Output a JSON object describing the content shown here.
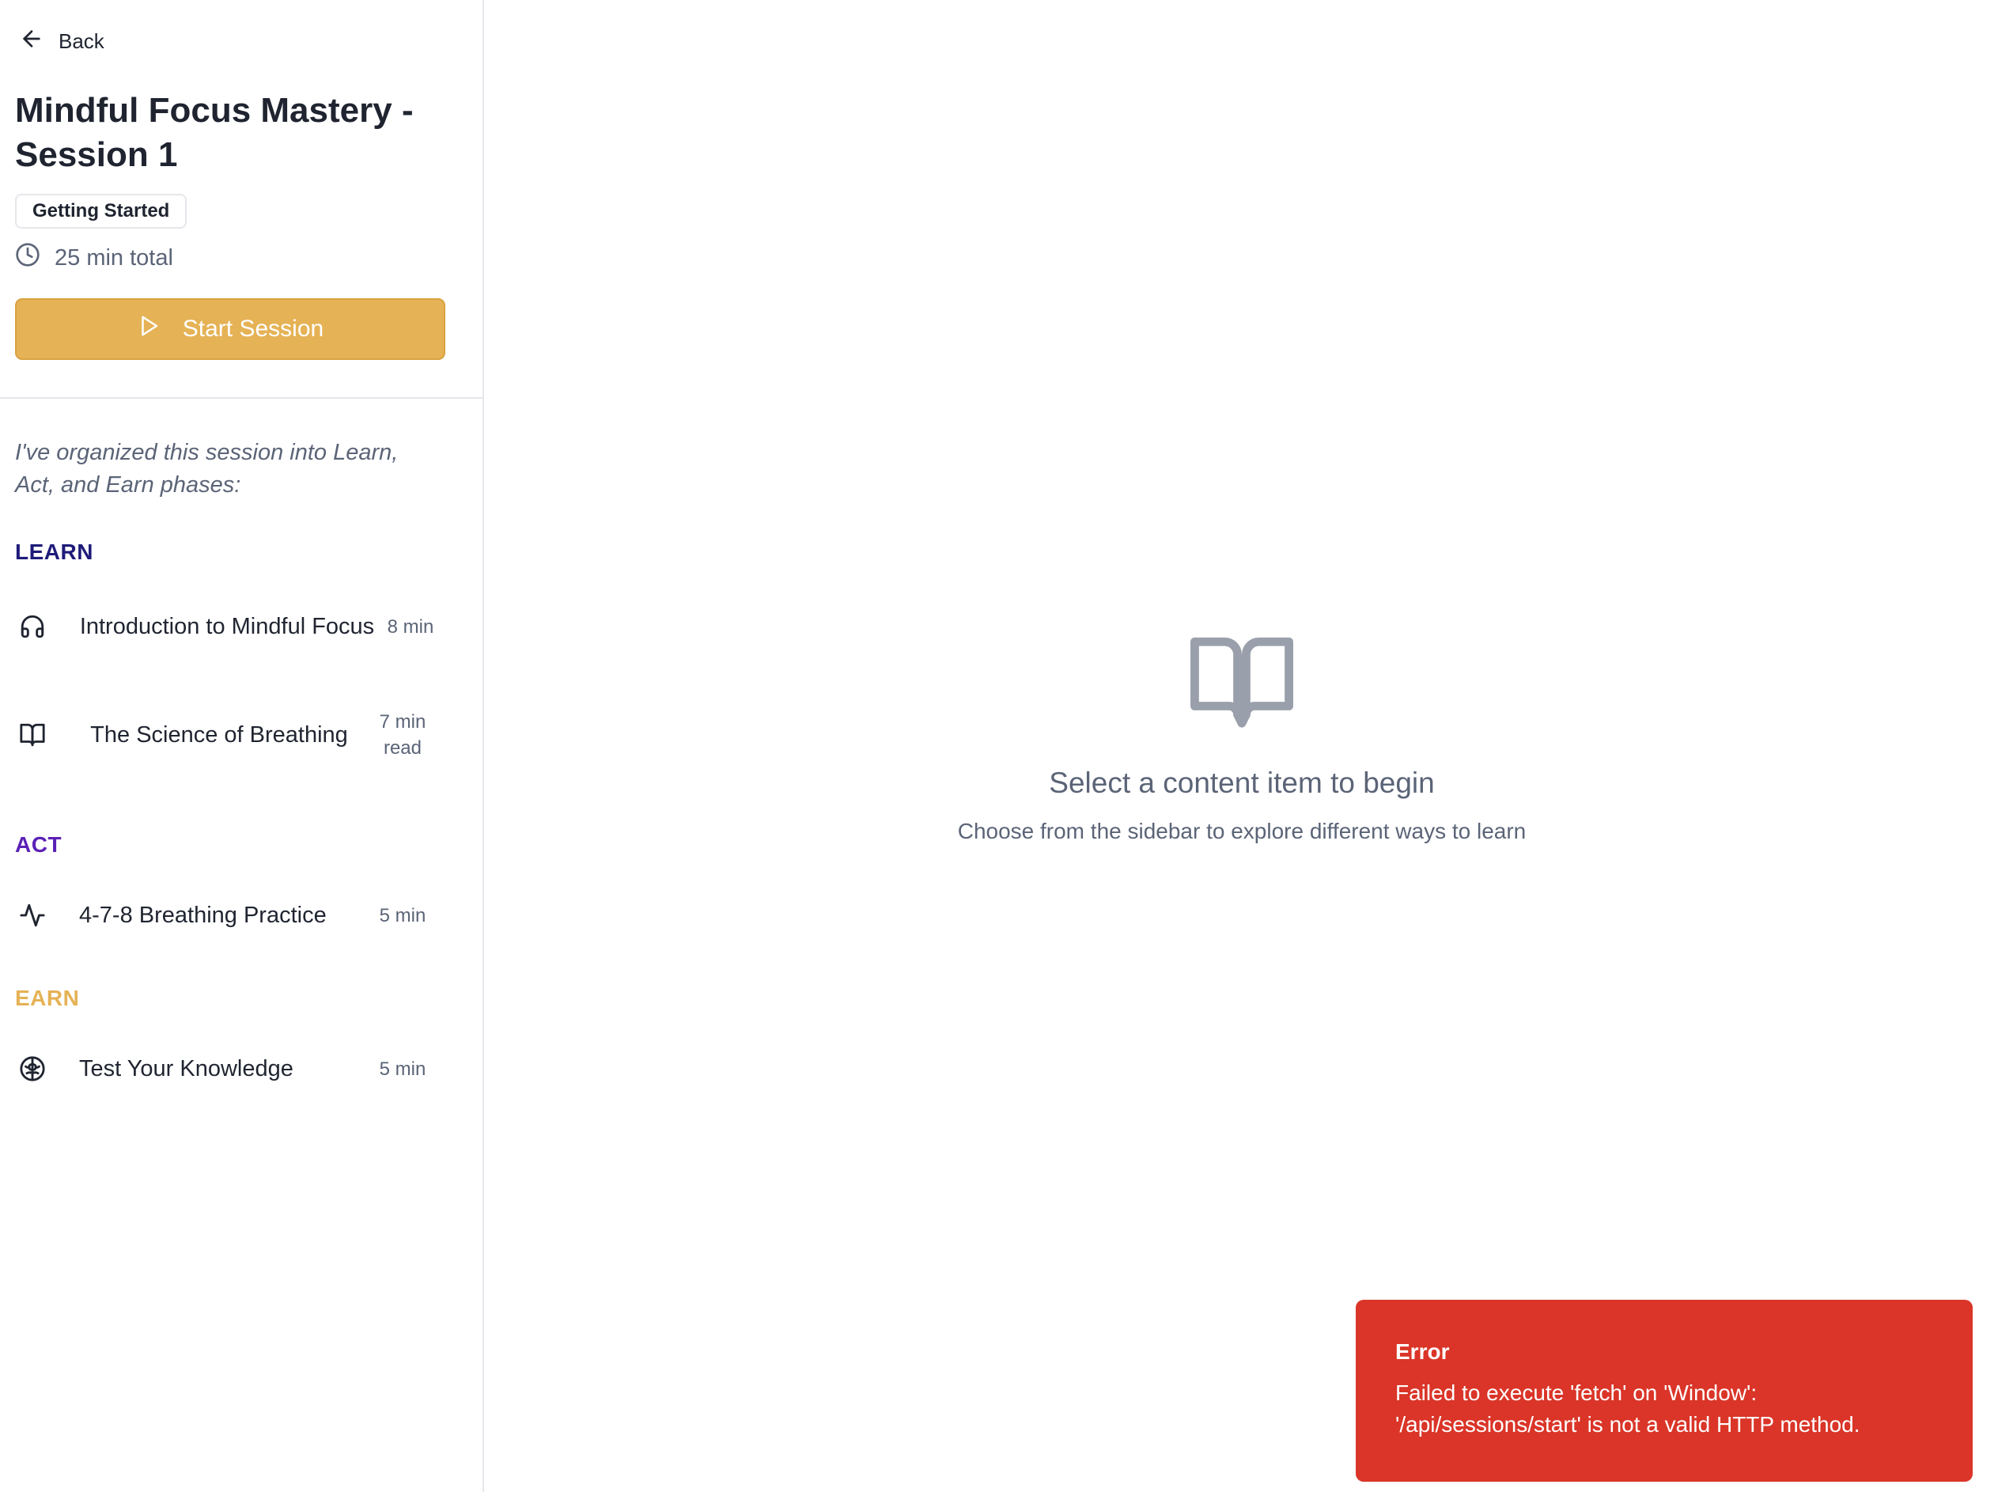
{
  "sidebar": {
    "back_label": "Back",
    "session_title": "Mindful Focus Mastery - Session 1",
    "tag": "Getting Started",
    "duration": "25 min total",
    "start_button": "Start Session",
    "intro": "I've organized this session into Learn, Act, and Earn phases:",
    "phases": [
      {
        "label": "LEARN",
        "color": "#1e1b7a",
        "items": [
          {
            "icon": "headphones-icon",
            "title": "Introduction to Mindful Focus",
            "duration": "8 min"
          },
          {
            "icon": "book-open-icon",
            "title": "The Science of Breathing",
            "duration": "7 min read"
          }
        ]
      },
      {
        "label": "ACT",
        "color": "#5b21b6",
        "items": [
          {
            "icon": "activity-icon",
            "title": "4-7-8 Breathing Practice",
            "duration": "5 min"
          }
        ]
      },
      {
        "label": "EARN",
        "color": "#e5b255",
        "items": [
          {
            "icon": "brain-icon",
            "title": "Test Your Knowledge",
            "duration": "5 min"
          }
        ]
      }
    ]
  },
  "main": {
    "empty_title": "Select a content item to begin",
    "empty_subtitle": "Choose from the sidebar to explore different ways to learn"
  },
  "toast": {
    "title": "Error",
    "message": "Failed to execute 'fetch' on 'Window': '/api/sessions/start' is not a valid HTTP method."
  },
  "colors": {
    "accent": "#e5b255",
    "error": "#da3528",
    "muted_text": "#5b6477"
  }
}
